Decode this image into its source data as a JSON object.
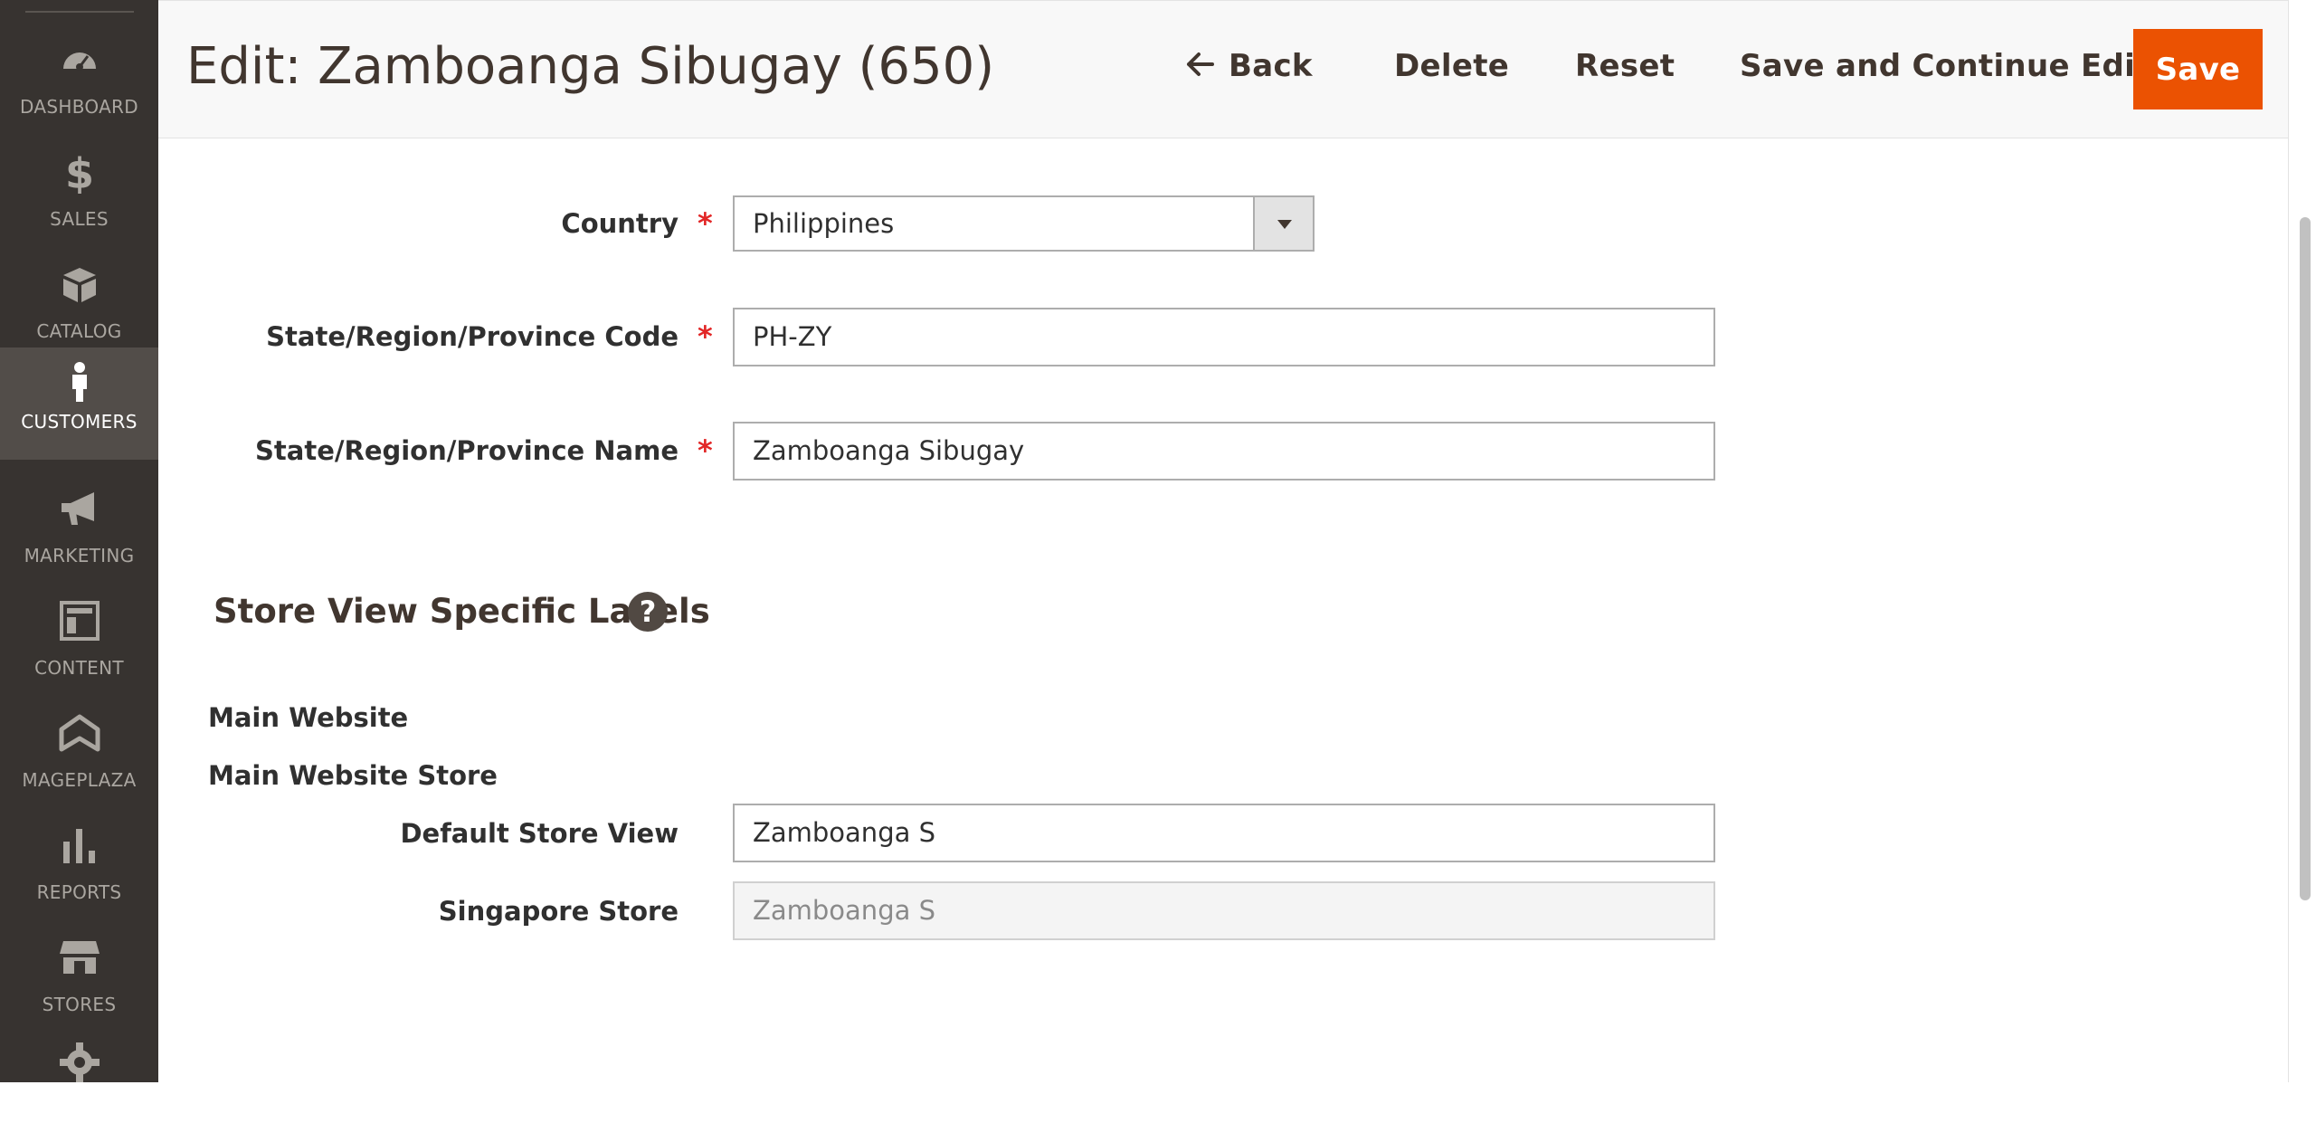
{
  "sidebar": {
    "items": [
      {
        "label": "DASHBOARD",
        "icon": "dashboard-icon"
      },
      {
        "label": "SALES",
        "icon": "dollar-icon"
      },
      {
        "label": "CATALOG",
        "icon": "box-icon"
      },
      {
        "label": "CUSTOMERS",
        "icon": "person-icon",
        "active": true
      },
      {
        "label": "MARKETING",
        "icon": "megaphone-icon"
      },
      {
        "label": "CONTENT",
        "icon": "layout-icon"
      },
      {
        "label": "MAGEPLAZA",
        "icon": "mageplaza-icon"
      },
      {
        "label": "REPORTS",
        "icon": "bar-chart-icon"
      },
      {
        "label": "STORES",
        "icon": "store-icon"
      },
      {
        "label": "",
        "icon": "gear-icon"
      }
    ]
  },
  "header": {
    "title": "Edit: Zamboanga Sibugay (650)",
    "back_label": "Back",
    "delete_label": "Delete",
    "reset_label": "Reset",
    "save_continue_label": "Save and Continue Edit",
    "save_label": "Save"
  },
  "form": {
    "required_mark": "*",
    "country": {
      "label": "Country",
      "value": "Philippines"
    },
    "code": {
      "label": "State/Region/Province Code",
      "value": "PH-ZY"
    },
    "name": {
      "label": "State/Region/Province Name",
      "value": "Zamboanga Sibugay"
    }
  },
  "store_labels": {
    "title": "Store View Specific Labels",
    "help": "?",
    "website": "Main Website",
    "store": "Main Website Store",
    "views": [
      {
        "label": "Default Store View",
        "value": "Zamboanga S",
        "disabled": false
      },
      {
        "label": "Singapore Store",
        "value": "Zamboanga S",
        "disabled": true
      }
    ]
  },
  "colors": {
    "accent": "#eb5202",
    "sidebar_bg": "#373330",
    "sidebar_active": "#524d49",
    "required": "#e22626"
  }
}
